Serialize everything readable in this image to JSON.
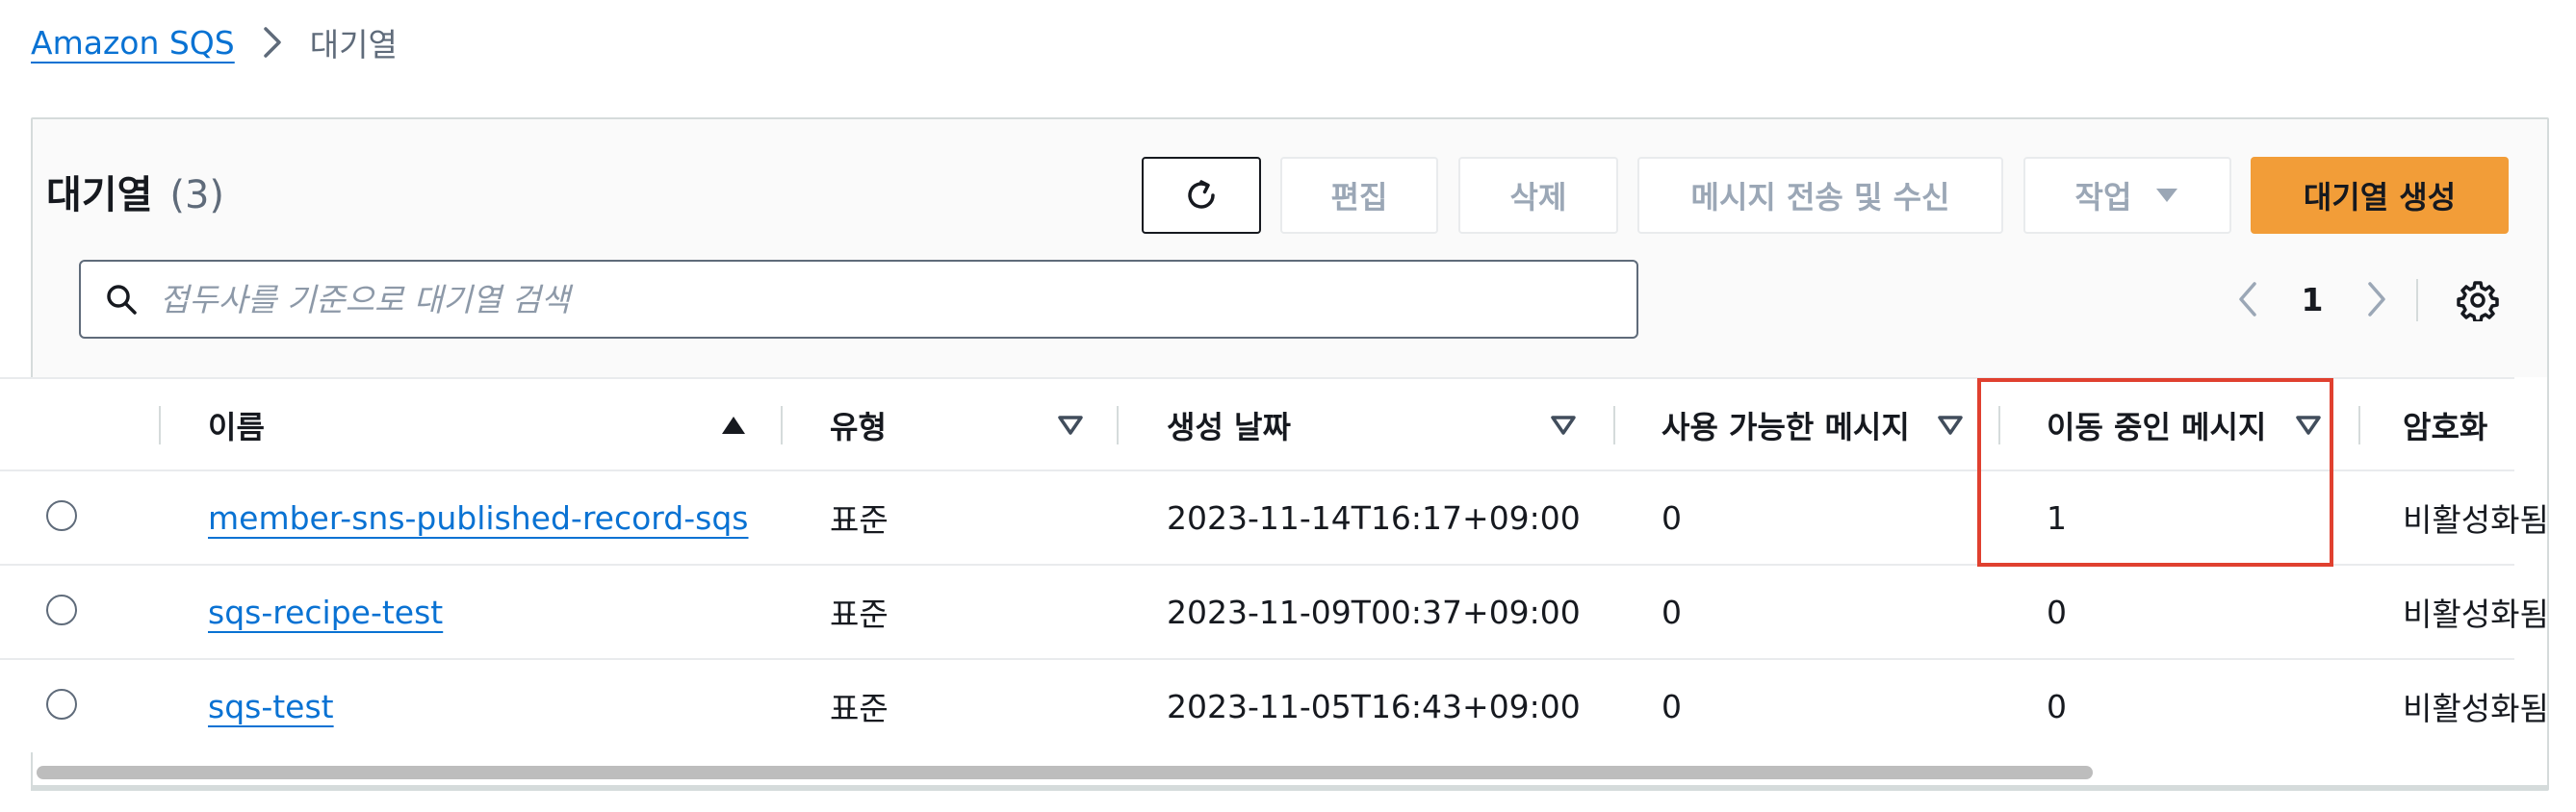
{
  "breadcrumb": {
    "root": "Amazon SQS",
    "current": "대기열"
  },
  "panel": {
    "title": "대기열",
    "count": "(3)",
    "buttons": {
      "refresh_icon": "refresh-icon",
      "edit": "편집",
      "delete": "삭제",
      "send_receive": "메시지 전송 및 수신",
      "actions": "작업",
      "create": "대기열 생성"
    },
    "search": {
      "placeholder": "접두사를 기준으로 대기열 검색",
      "value": ""
    },
    "pagination": {
      "current_page": "1"
    }
  },
  "table": {
    "columns": [
      {
        "label": "이름",
        "sort": "ascending"
      },
      {
        "label": "유형",
        "sort": "none"
      },
      {
        "label": "생성 날짜",
        "sort": "none"
      },
      {
        "label": "사용 가능한 메시지",
        "sort": "none"
      },
      {
        "label": "이동 중인 메시지",
        "sort": "none"
      },
      {
        "label": "암호화",
        "sort": "none"
      }
    ],
    "rows": [
      {
        "name": "member-sns-published-record-sqs",
        "type": "표준",
        "created": "2023-11-14T16:17+09:00",
        "available": "0",
        "in_flight": "1",
        "encryption": "비활성화됨"
      },
      {
        "name": "sqs-recipe-test",
        "type": "표준",
        "created": "2023-11-09T00:37+09:00",
        "available": "0",
        "in_flight": "0",
        "encryption": "비활성화됨"
      },
      {
        "name": "sqs-test",
        "type": "표준",
        "created": "2023-11-05T16:43+09:00",
        "available": "0",
        "in_flight": "0",
        "encryption": "비활성화됨"
      }
    ]
  },
  "colors": {
    "link": "#0972d3",
    "primary_button": "#f29d38",
    "highlight_box": "#e0402f",
    "disabled_text": "#9ba7b6"
  }
}
